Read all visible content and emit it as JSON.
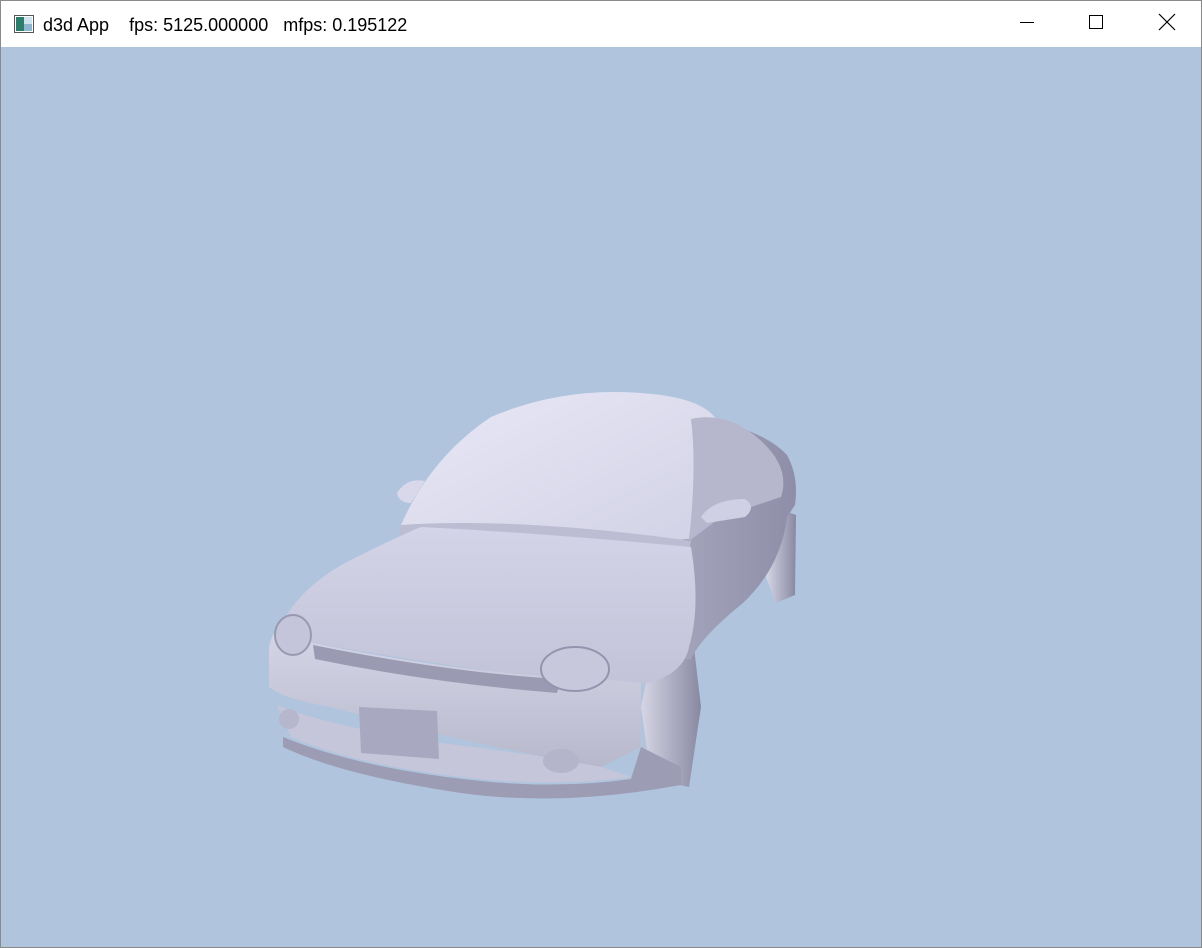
{
  "window": {
    "app_name": "d3d App",
    "fps_label": "fps: 5125.000000",
    "mfps_label": "mfps: 0.195122",
    "icons": {
      "app": "app-icon",
      "minimize": "minimize-icon",
      "maximize": "maximize-icon",
      "close": "close-icon"
    }
  },
  "scene": {
    "background_color": "#b0c4de",
    "model": "car-model"
  }
}
